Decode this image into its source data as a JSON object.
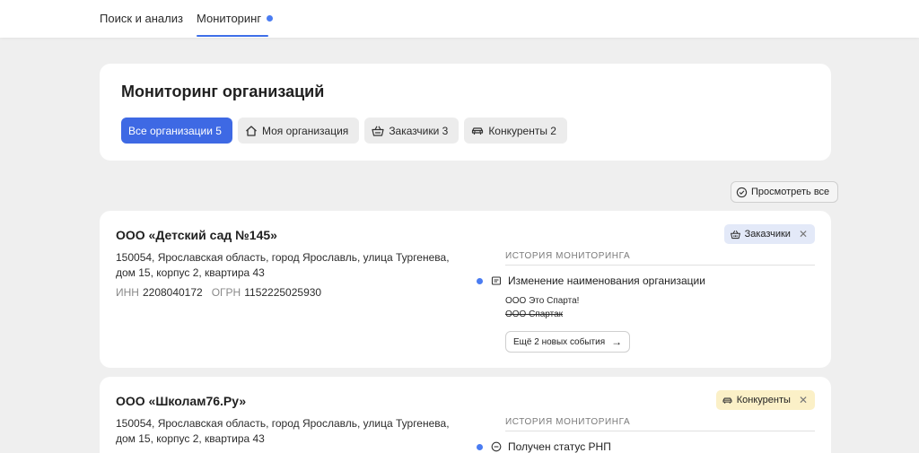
{
  "nav": {
    "tabs": [
      {
        "label": "Поиск и анализ"
      },
      {
        "label": "Мониторинг"
      }
    ]
  },
  "header": {
    "title": "Мониторинг организаций",
    "filters": [
      {
        "label": "Все организации 5",
        "active": true,
        "icon": "none"
      },
      {
        "label": "Моя организация",
        "icon": "house-icon"
      },
      {
        "label": "Заказчики 3",
        "icon": "basket-icon"
      },
      {
        "label": "Конкуренты 2",
        "icon": "car-icon"
      }
    ]
  },
  "view_all_label": "Просмотреть все",
  "orgs": [
    {
      "name": "ООО «Детский сад №145»",
      "address": "150054, Ярославская область, город Ярославль, улица Тургенева, дом 15, корпус 2, квартира 43",
      "inn_label": "ИНН",
      "inn": "2208040172",
      "ogrn_label": "ОГРН",
      "ogrn": "1152225025930",
      "tag": "Заказчики",
      "history_title": "ИСТОРИЯ МОНИТОРИНГА",
      "event": "Изменение наименования организации",
      "new_value": "ООО Это Спарта!",
      "old_value": "ООО Спартак",
      "more_label": "Ещё 2 новых события"
    },
    {
      "name": "ООО «Школам76.Ру»",
      "address": "150054, Ярославская область, город Ярославль, улица Тургенева, дом 15, корпус 2, квартира 43",
      "tag": "Конкуренты",
      "history_title": "ИСТОРИЯ МОНИТОРИНГА",
      "event": "Получен статус РНП"
    }
  ],
  "colors": {
    "accent": "#3e69e4",
    "customer_tag_bg": "#e3e9f8",
    "competitor_tag_bg": "#fbf0c7",
    "background": "#efefef"
  }
}
